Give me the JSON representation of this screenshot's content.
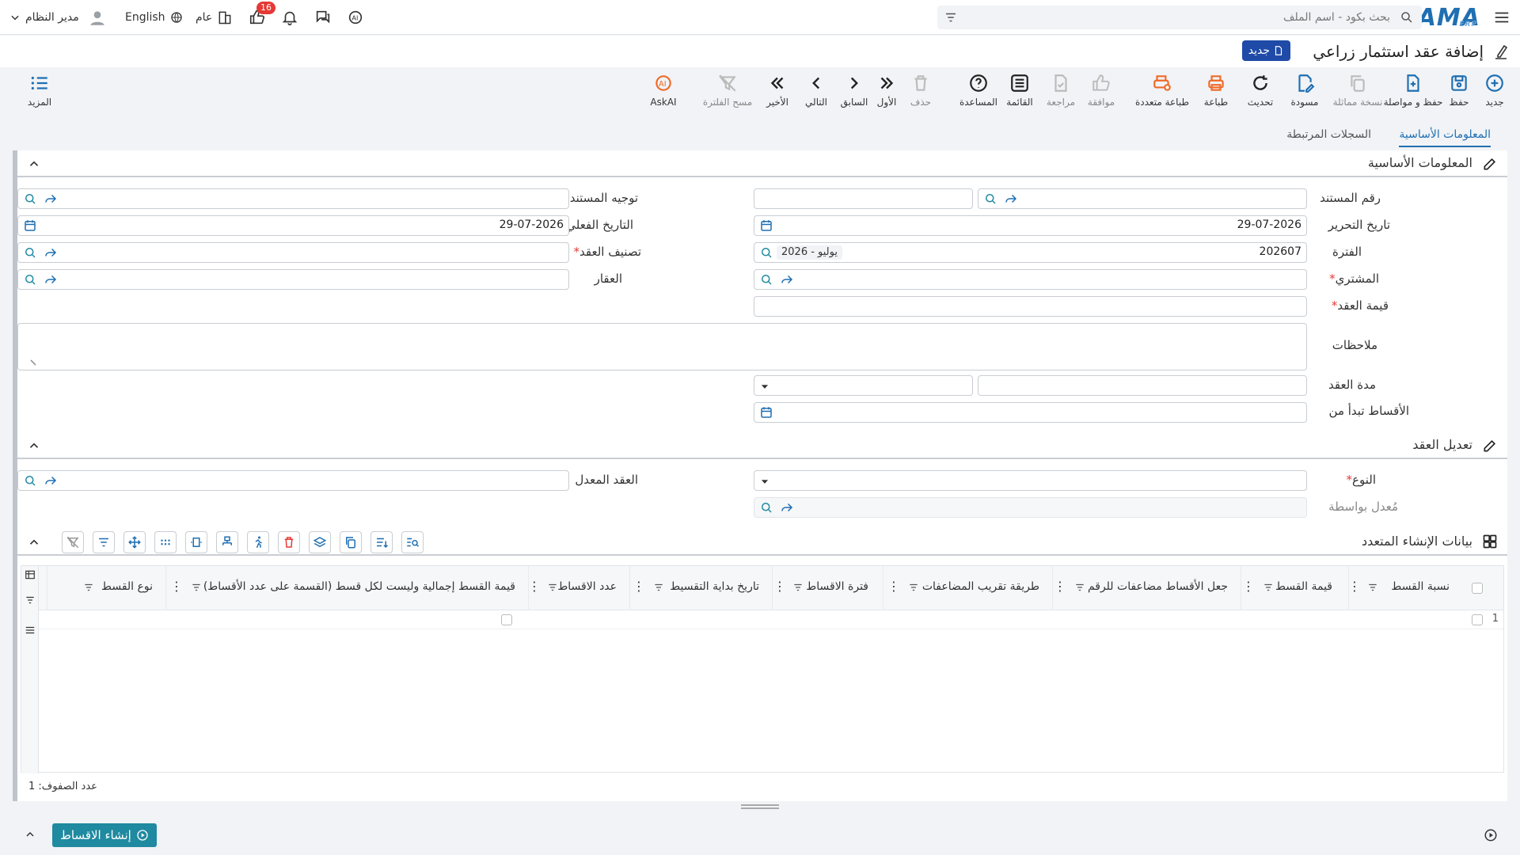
{
  "topbar": {
    "logo": "NAMA",
    "logo_sub": "ERP",
    "search_placeholder": "بحث بكود - اسم الملف",
    "user_name": "مدير النظام",
    "language": "English",
    "scope": "عام",
    "notifications_count": "16"
  },
  "page": {
    "title": "إضافة عقد استثمار زراعي",
    "status_badge": "جديد"
  },
  "toolbar": {
    "new": "جديد",
    "save": "حفظ",
    "save_continue": "حفظ و مواصلة",
    "copy": "نسخة مماثلة",
    "draft": "مسودة",
    "refresh": "تحديث",
    "print": "طباعة",
    "multi_print": "طباعة متعددة",
    "approve": "موافقة",
    "review": "مراجعة",
    "list": "القائمة",
    "help": "المساعدة",
    "delete": "حذف",
    "first": "الأول",
    "previous": "السابق",
    "next": "التالي",
    "last": "الأخير",
    "clear_filter": "مسح الفلترة",
    "askai": "AskAI",
    "more": "المزيد"
  },
  "tabs": {
    "basic": "المعلومات الأساسية",
    "related": "السجلات المرتبطة"
  },
  "section_basic": {
    "title": "المعلومات الأساسية",
    "doc_number_label": "رقم المستند",
    "doc_direction_label": "توجيه المستند",
    "edit_date_label": "تاريخ التحرير",
    "edit_date_value": "29-07-2026",
    "actual_date_label": "التاريخ الفعلي",
    "actual_date_value": "29-07-2026",
    "period_label": "الفترة",
    "period_value": "202607",
    "period_chip": "2026 - يوليو",
    "contract_class_label": "تصنيف العقد",
    "buyer_label": "المشتري",
    "property_label": "العقار",
    "contract_value_label": "قيمة العقد",
    "notes_label": "ملاحظات",
    "duration_label": "مدة العقد",
    "installments_start_label": "الأقساط تبدأ من"
  },
  "section_amend": {
    "title": "تعديل العقد",
    "type_label": "النوع",
    "amended_contract_label": "العقد المعدل",
    "modified_by_label": "مُعدل بواسطة"
  },
  "section_multi": {
    "title": "بيانات الإنشاء المتعدد"
  },
  "grid": {
    "columns": [
      "نسبة القسط",
      "قيمة القسط",
      "جعل الأقساط مضاعفات للرقم",
      "طريقة تقريب المضاعفات",
      "فترة الاقساط",
      "تاريخ بداية التقسيط",
      "عدد الاقساط",
      "قيمة القسط إجمالية وليست لكل قسط (القسمة على عدد الأقساط)",
      "نوع القسط"
    ],
    "row_number": "1",
    "row_count_label": "عدد الصفوف: 1"
  },
  "bottom": {
    "generate_button": "إنشاء الاقساط"
  },
  "colors": {
    "primary": "#1f6fb2",
    "print_orange": "#f06a28",
    "badge_red": "#e53935",
    "generate_teal": "#1f8aa0"
  }
}
